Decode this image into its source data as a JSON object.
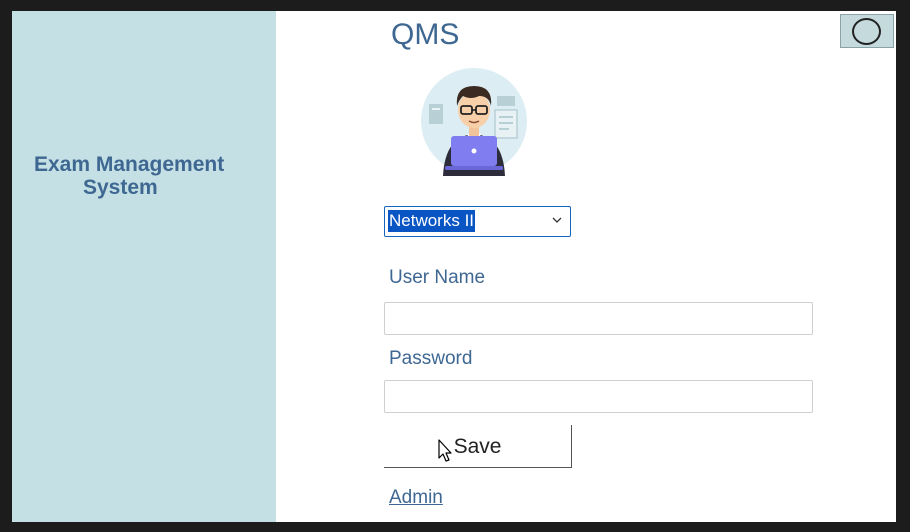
{
  "app": {
    "title": "QMS"
  },
  "sidebar": {
    "title_line1": "Exam Management",
    "title_line2": "System"
  },
  "controls": {
    "close_icon": "circle-icon"
  },
  "avatar": {
    "icon": "user-with-laptop-illustration"
  },
  "form": {
    "course_select": {
      "selected": "Networks II"
    },
    "username": {
      "label": "User Name",
      "value": ""
    },
    "password": {
      "label": "Password",
      "value": ""
    },
    "save_label": "Save",
    "admin_link": "Admin"
  },
  "colors": {
    "sidebar_bg": "#c4e0e4",
    "accent_text": "#3e6792",
    "selection": "#0a55c4"
  }
}
